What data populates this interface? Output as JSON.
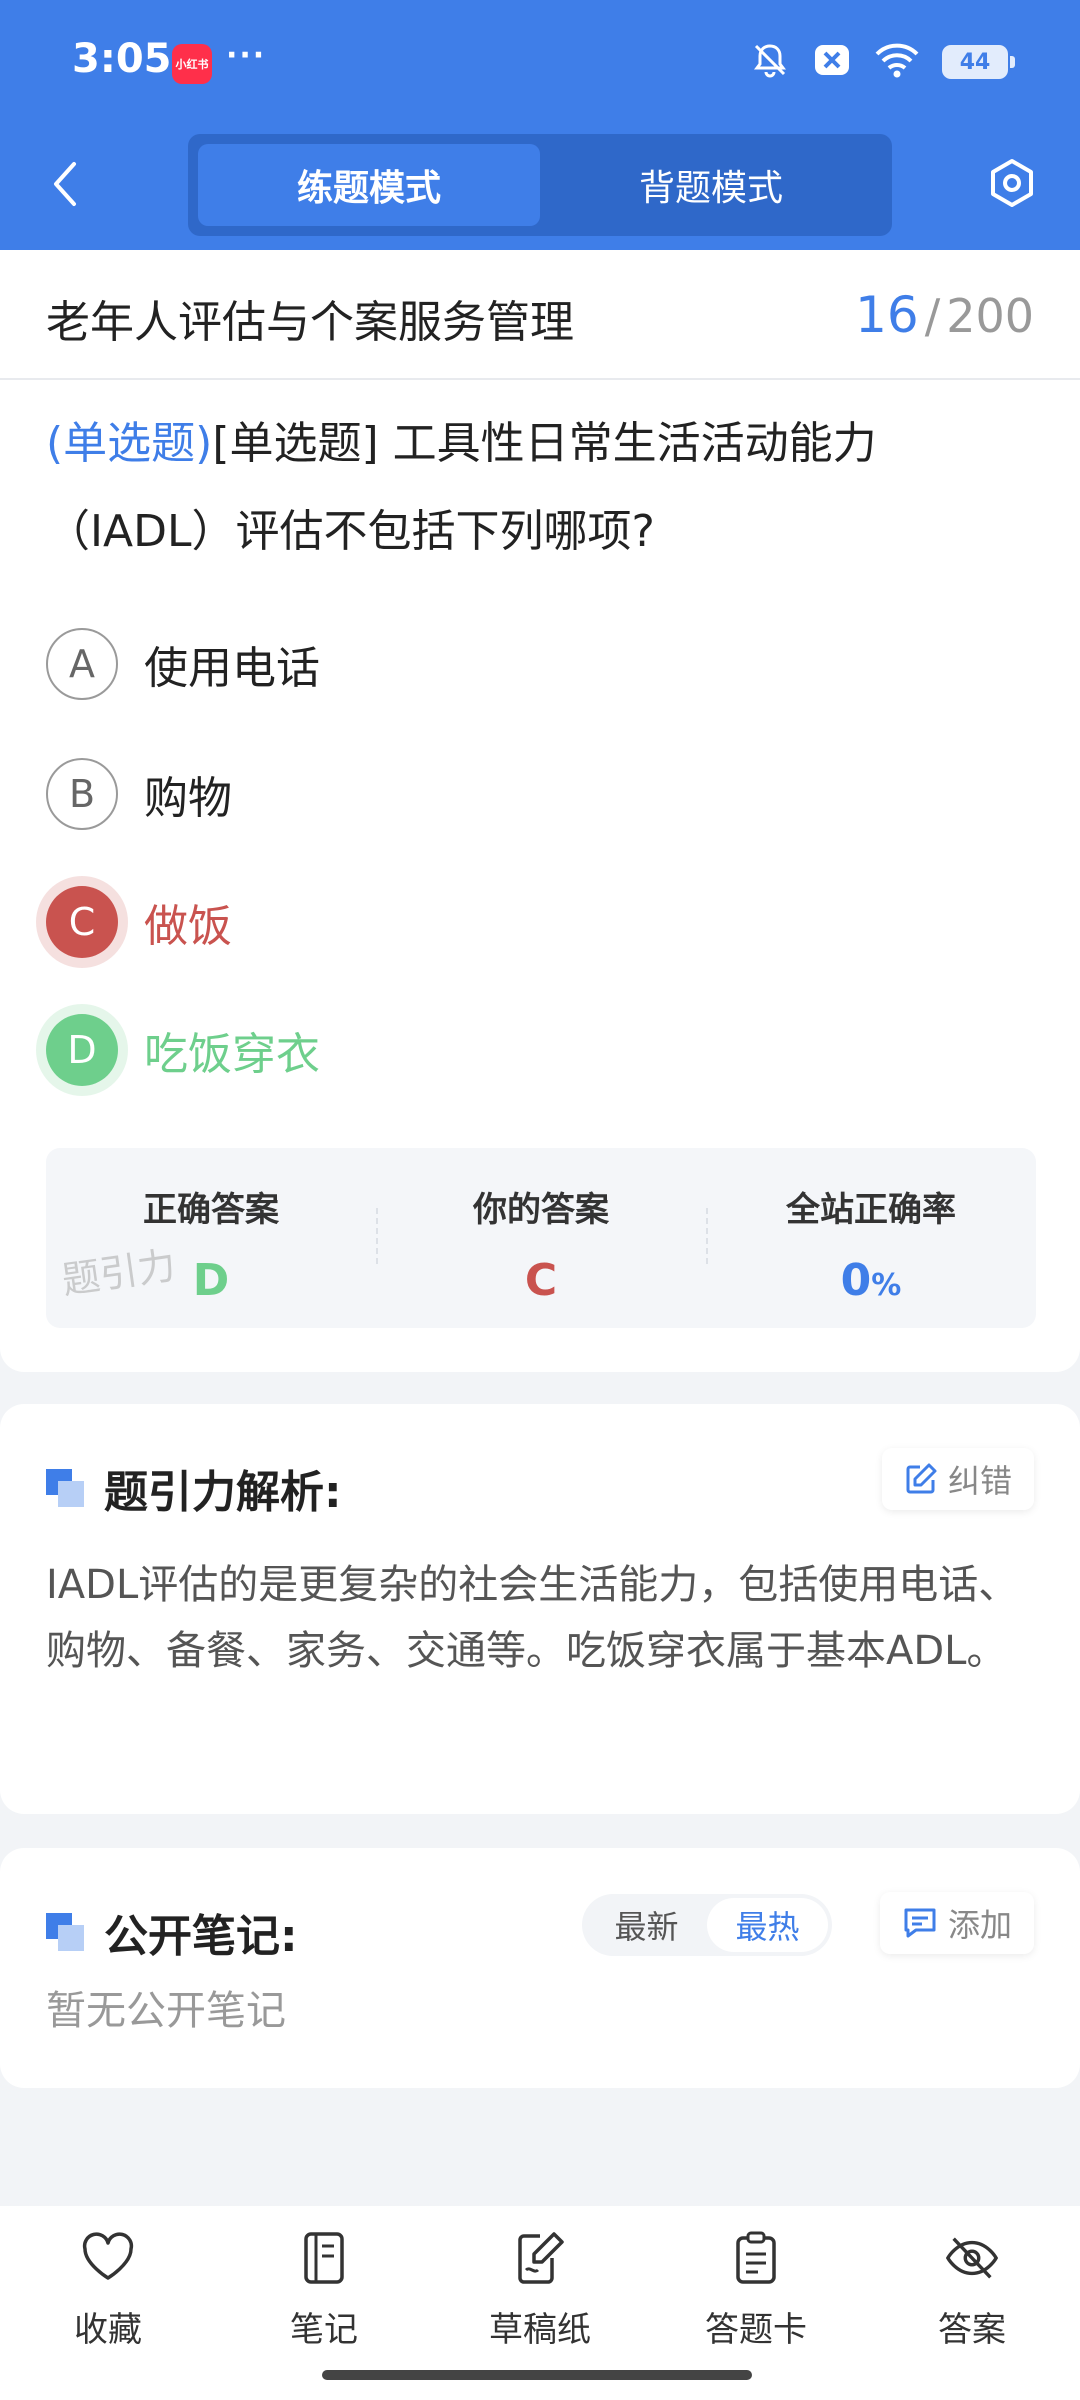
{
  "status_bar": {
    "time": "3:05",
    "app_badge": "小红书",
    "dots": "···",
    "battery": "44",
    "icons": [
      "mute-bell-icon",
      "close-badge-icon",
      "wifi-icon",
      "battery-icon"
    ]
  },
  "header": {
    "tabs": [
      {
        "label": "练题模式",
        "active": true
      },
      {
        "label": "背题模式",
        "active": false
      }
    ]
  },
  "subject": {
    "title": "老年人评估与个案服务管理",
    "current": "16",
    "total": "200"
  },
  "question": {
    "type_tag": "(单选题)",
    "text": "[单选题] 工具性日常生活活动能力（IADL）评估不包括下列哪项?"
  },
  "options": [
    {
      "letter": "A",
      "text": "使用电话",
      "state": "normal"
    },
    {
      "letter": "B",
      "text": "购物",
      "state": "normal"
    },
    {
      "letter": "C",
      "text": "做饭",
      "state": "wrong"
    },
    {
      "letter": "D",
      "text": "吃饭穿衣",
      "state": "right"
    }
  ],
  "answer_summary": {
    "correct_label": "正确答案",
    "correct_value": "D",
    "yours_label": "你的答案",
    "yours_value": "C",
    "rate_label": "全站正确率",
    "rate_value": "0",
    "rate_unit": "%",
    "watermark": "题引力"
  },
  "analysis": {
    "title": "题引力解析:",
    "report_label": "纠错",
    "text": "IADL评估的是更复杂的社会生活能力，包括使用电话、购物、备餐、家务、交通等。吃饭穿衣属于基本ADL。"
  },
  "notes": {
    "title": "公开笔记:",
    "sort_latest": "最新",
    "sort_hot": "最热",
    "add_label": "添加",
    "empty_text": "暂无公开笔记"
  },
  "bottom_nav": {
    "favorite": "收藏",
    "notes": "笔记",
    "draft": "草稿纸",
    "answer_card": "答题卡",
    "answer": "答案"
  },
  "colors": {
    "primary": "#3f7ee8",
    "wrong": "#c9534f",
    "right": "#6ecf8c"
  }
}
